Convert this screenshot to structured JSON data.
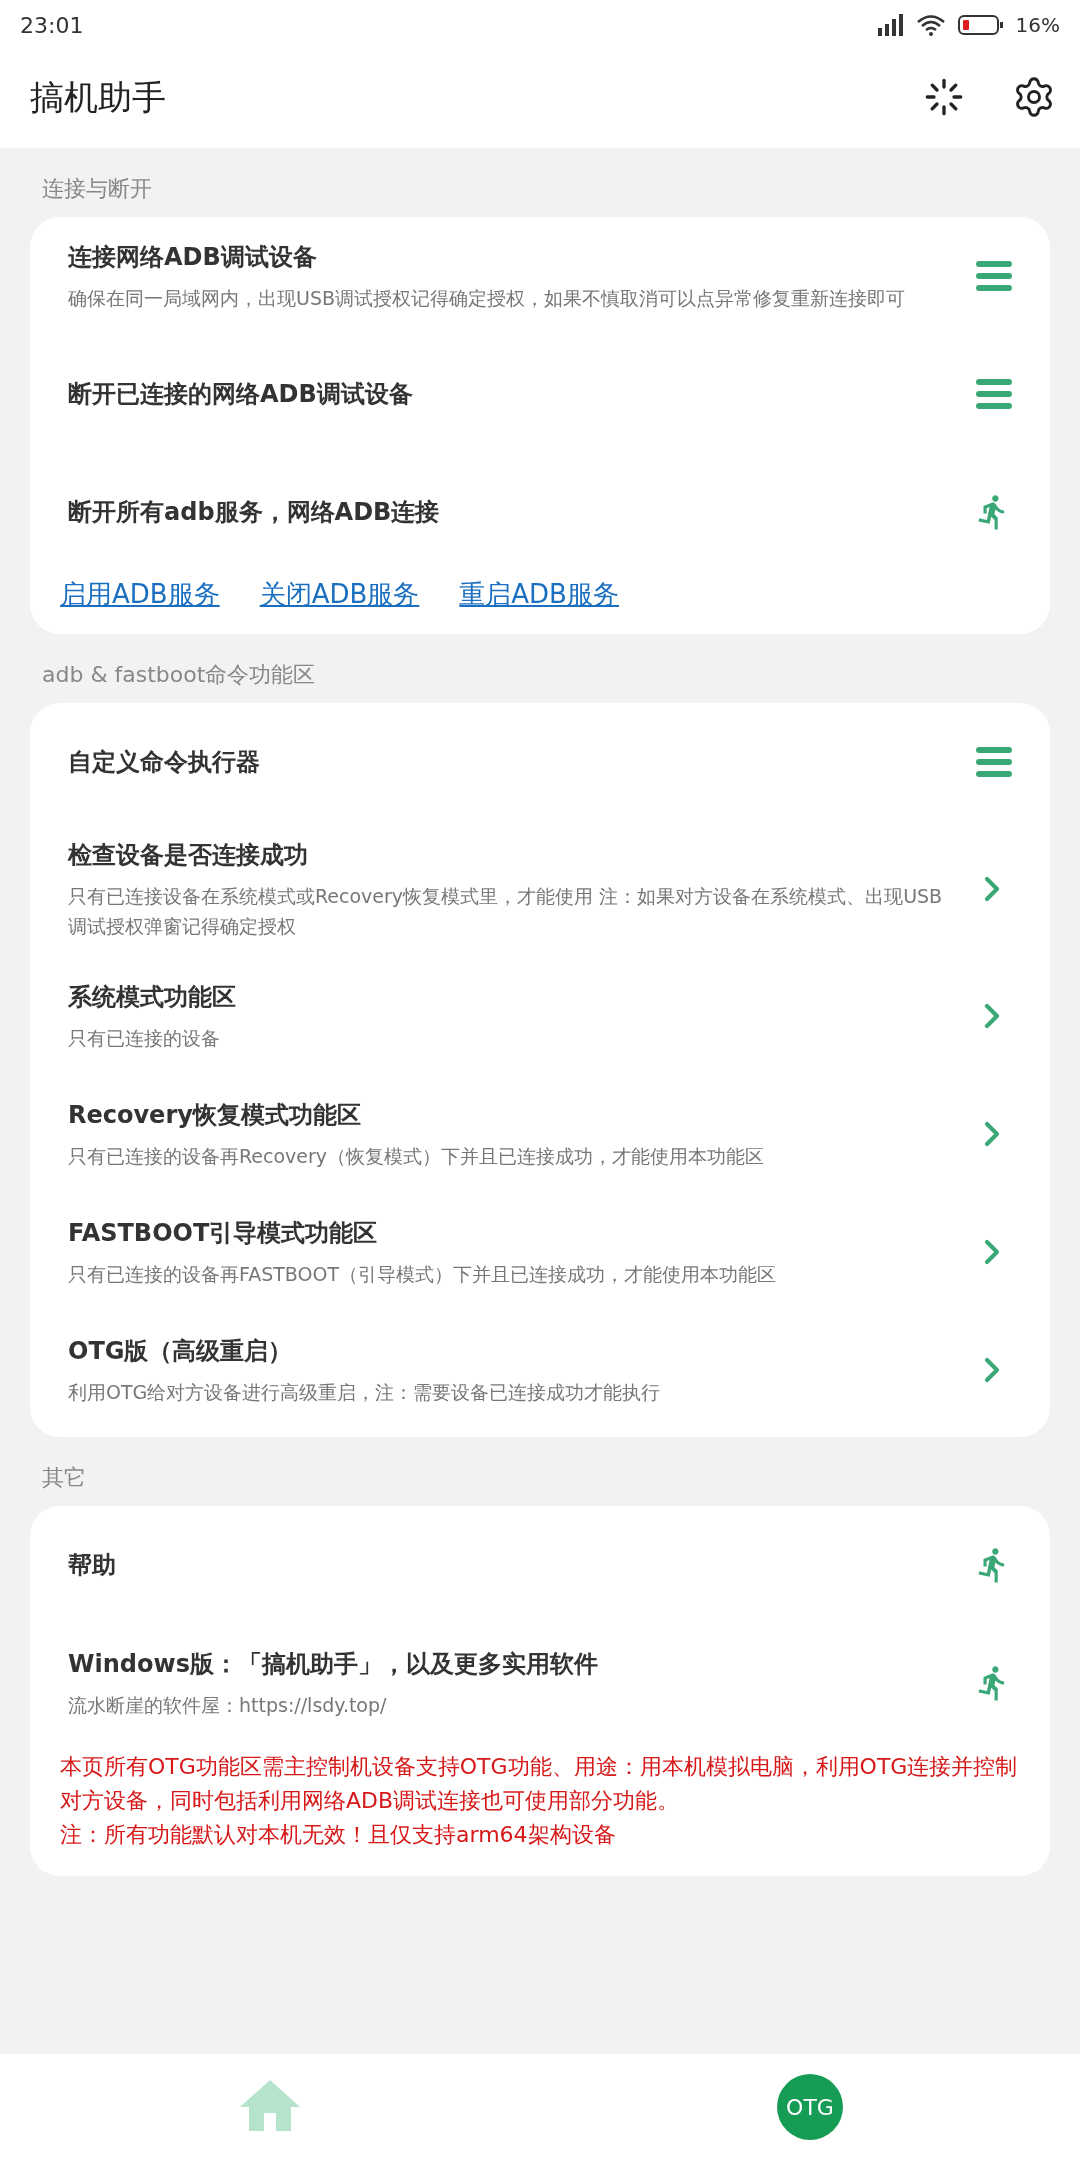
{
  "status_bar": {
    "time": "23:01",
    "battery": "16%"
  },
  "app_bar": {
    "title": "搞机助手"
  },
  "sections": [
    {
      "header": "连接与断开",
      "rows": [
        {
          "kind": "menu",
          "title": "连接网络ADB调试设备",
          "description": "确保在同一局域网内，出现USB调试授权记得确定授权，如果不慎取消可以点异常修复重新连接即可"
        },
        {
          "kind": "menu",
          "title": "断开已连接的网络ADB调试设备"
        },
        {
          "kind": "run",
          "title": "断开所有adb服务，网络ADB连接"
        }
      ],
      "links": [
        "启用ADB服务",
        "关闭ADB服务",
        "重启ADB服务"
      ]
    },
    {
      "header": "adb & fastboot命令功能区",
      "rows": [
        {
          "kind": "menu",
          "title": "自定义命令执行器"
        },
        {
          "kind": "chevron",
          "title": "检查设备是否连接成功",
          "description": "只有已连接设备在系统模式或Recovery恢复模式里，才能使用 注：如果对方设备在系统模式、出现USB调试授权弹窗记得确定授权"
        },
        {
          "kind": "chevron",
          "title": "系统模式功能区",
          "description": "只有已连接的设备"
        },
        {
          "kind": "chevron",
          "title": "Recovery恢复模式功能区",
          "description": "只有已连接的设备再Recovery（恢复模式）下并且已连接成功，才能使用本功能区"
        },
        {
          "kind": "chevron",
          "title": "FASTBOOT引导模式功能区",
          "description": "只有已连接的设备再FASTBOOT（引导模式）下并且已连接成功，才能使用本功能区"
        },
        {
          "kind": "chevron",
          "title": "OTG版（高级重启）",
          "description": "利用OTG给对方设备进行高级重启，注：需要设备已连接成功才能执行"
        }
      ]
    },
    {
      "header": "其它",
      "rows": [
        {
          "kind": "run",
          "title": "帮助"
        },
        {
          "kind": "run",
          "title": "Windows版：「搞机助手」，以及更多实用软件",
          "description": "流水断崖的软件屋：https://lsdy.top/"
        }
      ],
      "notes": [
        "本页所有OTG功能区需主控制机设备支持OTG功能、用途：用本机模拟电脑，利用OTG连接并控制对方设备，同时包括利用网络ADB调试连接也可使用部分功能。",
        "注：所有功能默认对本机无效！且仅支持arm64架构设备"
      ]
    }
  ],
  "bottom_nav": [
    {
      "kind": "home",
      "selected": false
    },
    {
      "kind": "otg",
      "label": "OTG",
      "selected": true
    }
  ]
}
